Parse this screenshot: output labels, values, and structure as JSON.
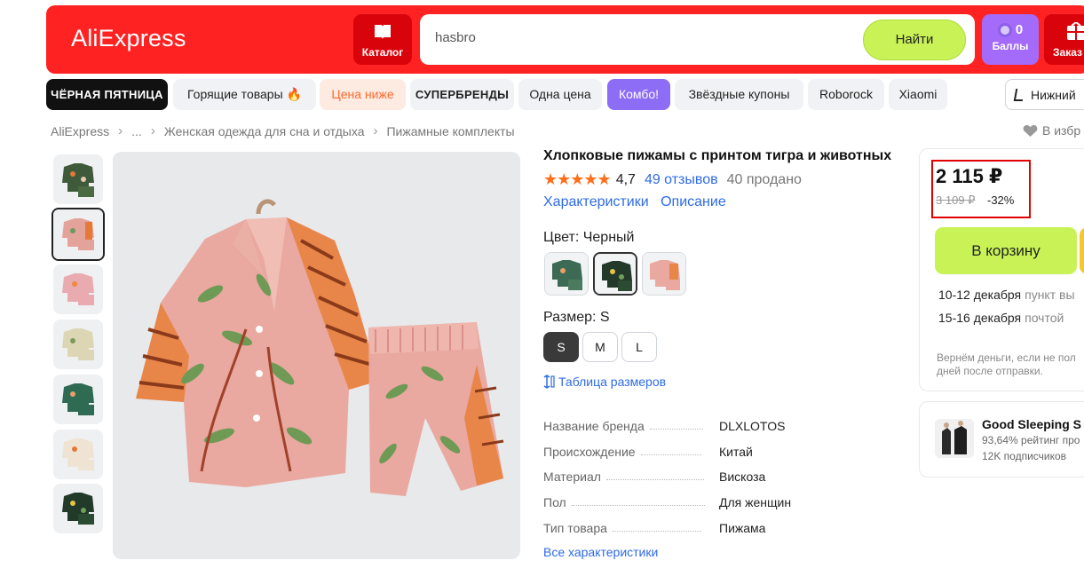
{
  "header": {
    "logo": "AliExpress",
    "catalog_label": "Каталог",
    "search_value": "hasbro",
    "search_button": "Найти",
    "points_count": "0",
    "points_label": "Баллы",
    "orders_label": "Заказ",
    "brand_color": "#ff2222",
    "accent_color": "#c8f255"
  },
  "chips": [
    {
      "label": "ЧЁРНАЯ ПЯТНИЦА"
    },
    {
      "label": "Горящие товары 🔥"
    },
    {
      "label": "Цена ниже"
    },
    {
      "label": "СУПЕРБРЕНДЫ"
    },
    {
      "label": "Одна цена"
    },
    {
      "label": "Комбо!"
    },
    {
      "label": "Звёздные купоны"
    },
    {
      "label": "Roborock"
    },
    {
      "label": "Xiaomi"
    },
    {
      "label": "Нижний"
    }
  ],
  "breadcrumb": [
    "AliExpress",
    "...",
    "Женская одежда для сна и отдыха",
    "Пижамные комплекты"
  ],
  "favorites_label": "В избр",
  "product": {
    "title": "Хлопковые пижамы с принтом тигра и животных",
    "stars": "★★★★★",
    "rating": "4,7",
    "reviews": "49 отзывов",
    "sold": "40 продано",
    "link_specs": "Характеристики",
    "link_description": "Описание",
    "color_label": "Цвет: Черный",
    "size_label": "Размер: S",
    "sizes": [
      "S",
      "M",
      "L"
    ],
    "size_table": "Таблица размеров",
    "specs": [
      {
        "name": "Название бренда",
        "value": "DLXLOTOS"
      },
      {
        "name": "Происхождение",
        "value": "Китай"
      },
      {
        "name": "Материал",
        "value": "Вискоза"
      },
      {
        "name": "Пол",
        "value": "Для женщин"
      },
      {
        "name": "Тип товара",
        "value": "Пижама"
      }
    ],
    "all_specs": "Все характеристики"
  },
  "buy": {
    "price": "2 115 ₽",
    "old_price": "3 109 ₽",
    "discount": "-32%",
    "cart_button": "В корзину",
    "delivery": [
      {
        "date": "10-12 декабря",
        "method": "пункт вы"
      },
      {
        "date": "15-16 декабря",
        "method": "почтой"
      }
    ],
    "refund": "Вернём деньги, если не пол дней после отправки."
  },
  "store": {
    "name": "Good Sleeping S",
    "rating": "93,64% рейтинг про",
    "subscribers": "12K подписчиков"
  }
}
